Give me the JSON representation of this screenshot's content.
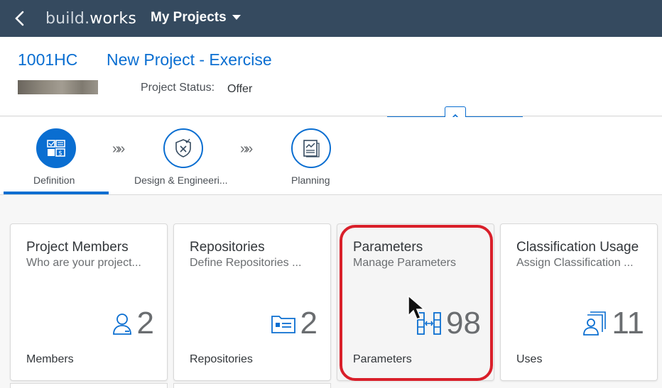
{
  "shell": {
    "logo_prefix": "build.",
    "logo_suffix": "works",
    "menu_label": "My Projects"
  },
  "header": {
    "project_id": "1001HC",
    "project_title": "New Project - Exercise",
    "status_label": "Project Status:",
    "status_value": "Offer"
  },
  "flow": {
    "steps": [
      {
        "label": "Definition",
        "icon": "definition-icon",
        "active": true
      },
      {
        "label": "Design & Engineeri...",
        "icon": "shield-check-icon",
        "active": false
      },
      {
        "label": "Planning",
        "icon": "planning-icon",
        "active": false
      }
    ],
    "separator": "»»"
  },
  "tiles": [
    {
      "title": "Project Members",
      "subtitle": "Who are your project...",
      "icon": "person-icon",
      "value": "2",
      "footer": "Members"
    },
    {
      "title": "Repositories",
      "subtitle": "Define Repositories ...",
      "icon": "folder-card-icon",
      "value": "2",
      "footer": "Repositories"
    },
    {
      "title": "Parameters",
      "subtitle": "Manage Parameters",
      "icon": "parameters-icon",
      "value": "98",
      "footer": "Parameters"
    },
    {
      "title": "Classification Usage",
      "subtitle": "Assign Classification ...",
      "icon": "classification-icon",
      "value": "11",
      "footer": "Uses"
    }
  ],
  "colors": {
    "shell_bg": "#354a5f",
    "accent": "#0a6ed1",
    "highlight": "#d91f2a"
  }
}
